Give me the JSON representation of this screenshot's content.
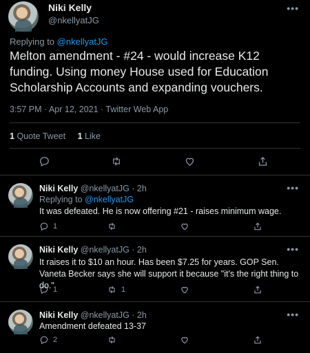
{
  "main": {
    "name": "Niki Kelly",
    "handle": "@nkellyatJG",
    "replying_prefix": "Replying to ",
    "replying_to": "@nkellyatJG",
    "text": "Melton amendment - #24 - would increase K12 funding. Using money House used for Education Scholarship Accounts and expanding vouchers.",
    "meta": "3:57 PM · Apr 12, 2021 · Twitter Web App",
    "quote_count": "1",
    "quote_label": "Quote Tweet",
    "like_count": "1",
    "like_label": "Like"
  },
  "replies": [
    {
      "name": "Niki Kelly",
      "handle": "@nkellyatJG",
      "time": "· 2h",
      "replying_prefix": "Replying to ",
      "replying_to": "@nkellyatJG",
      "text": "It was defeated. He is now offering #21 - raises minimum wage.",
      "reply_count": "1",
      "retweet_count": "",
      "like_count": ""
    },
    {
      "name": "Niki Kelly",
      "handle": "@nkellyatJG",
      "time": "· 2h",
      "text": "It raises it to $10 an hour. Has been $7.25 for years. GOP Sen. Vaneta Becker says she will support it because \"it's the right thing to do.\"",
      "reply_count": "1",
      "retweet_count": "1",
      "like_count": ""
    },
    {
      "name": "Niki Kelly",
      "handle": "@nkellyatJG",
      "time": "· 2h",
      "text": "Amendment defeated 13-37",
      "reply_count": "2",
      "retweet_count": "",
      "like_count": ""
    }
  ],
  "icons": {
    "more": "more-icon",
    "reply": "reply-icon",
    "retweet": "retweet-icon",
    "like": "like-icon",
    "share": "share-icon"
  },
  "colors": {
    "background": "#000000",
    "accent": "#1d9bf0",
    "muted": "#8b98a5",
    "divider": "#2f3336"
  }
}
